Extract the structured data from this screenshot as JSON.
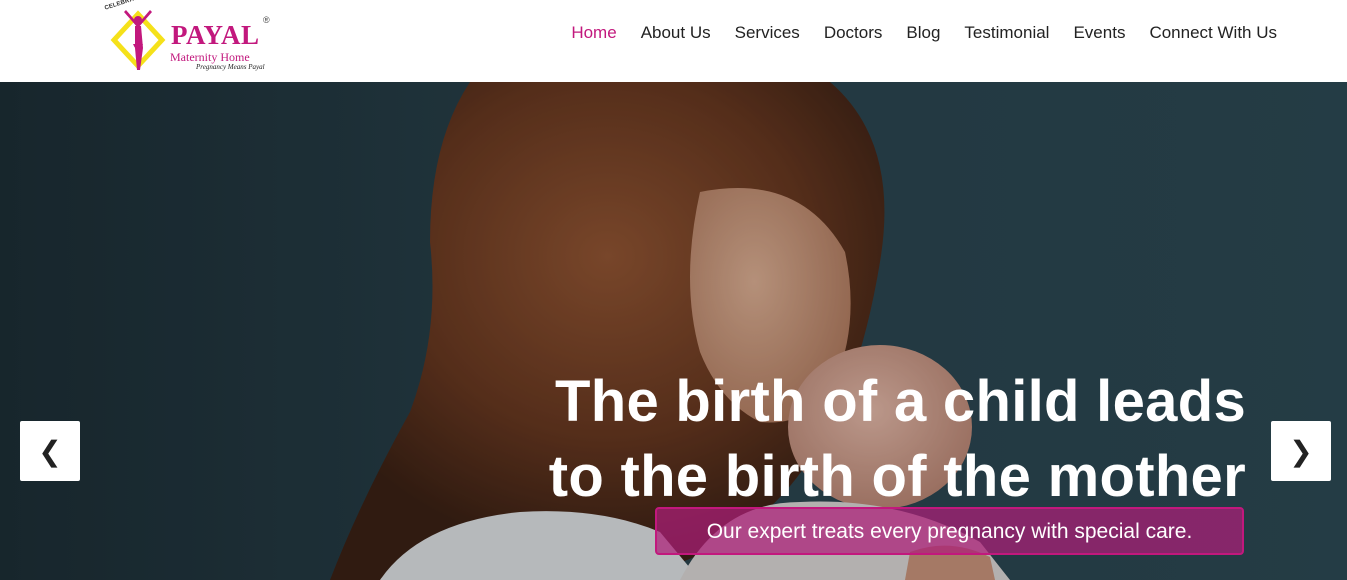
{
  "logo": {
    "arc_text": "CELEBRATING MOTHERHOOD",
    "brand": "PAYAL",
    "registered": "®",
    "subtitle": "Maternity Home",
    "tagline": "Pregnancy Means Payal",
    "brand_color": "#c2187d",
    "accent_color": "#f5e11a"
  },
  "nav": {
    "items": [
      {
        "label": "Home",
        "active": true
      },
      {
        "label": "About Us"
      },
      {
        "label": "Services"
      },
      {
        "label": "Doctors"
      },
      {
        "label": "Blog"
      },
      {
        "label": "Testimonial"
      },
      {
        "label": "Events"
      },
      {
        "label": "Connect With Us"
      }
    ],
    "active_color": "#c2187d"
  },
  "hero": {
    "headline_line1": "The birth of a child leads",
    "headline_line2": "to the birth of the mother",
    "subline": "Our expert treats every pregnancy with special care.",
    "prev_icon": "chevron-left-icon",
    "next_icon": "chevron-right-icon",
    "prev_glyph": "❮",
    "next_glyph": "❯"
  }
}
